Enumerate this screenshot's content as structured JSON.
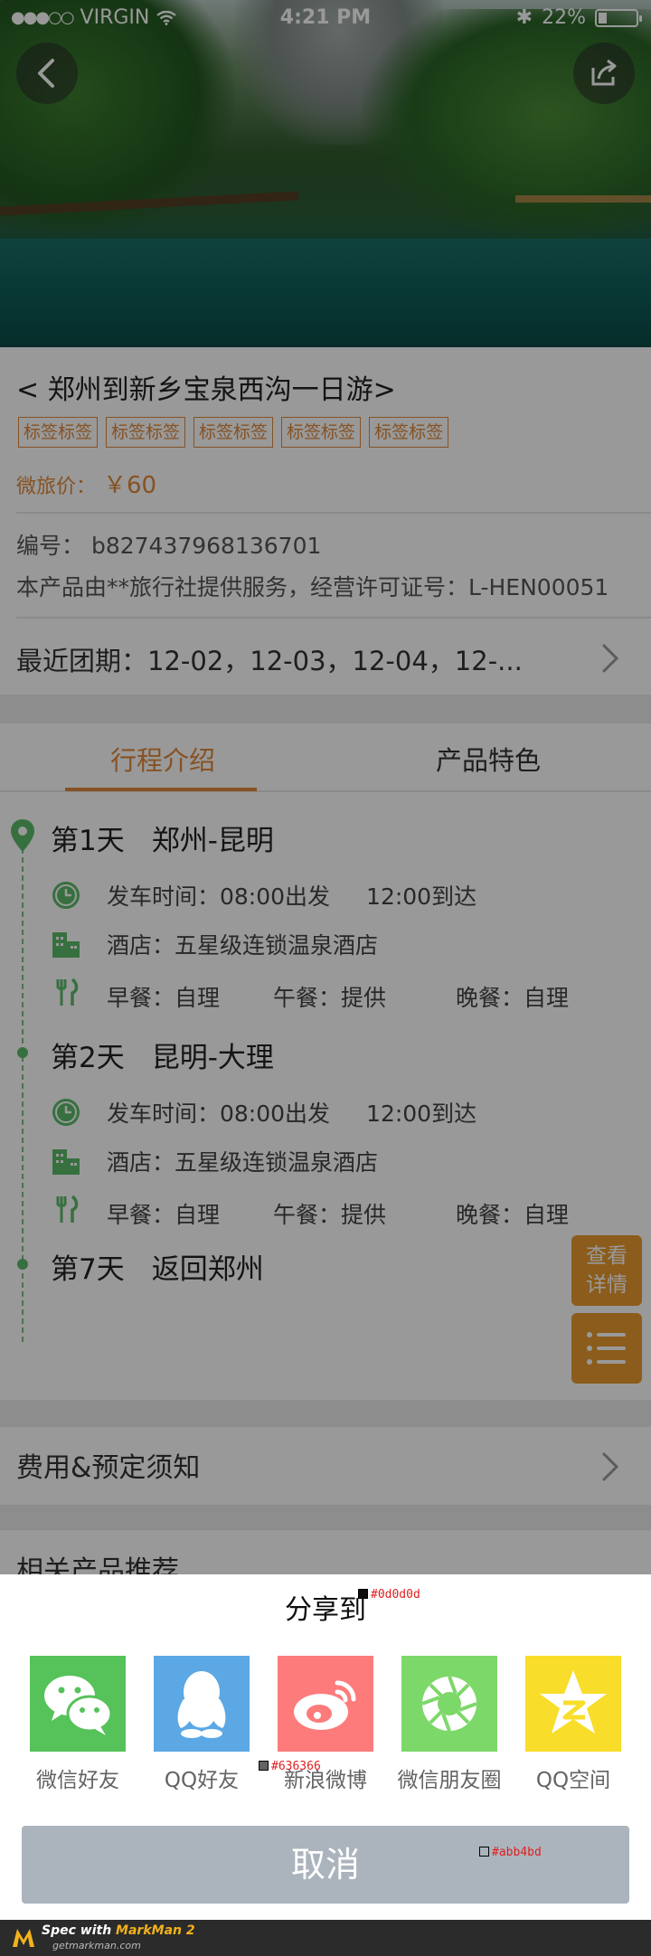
{
  "status_bar": {
    "carrier": "VIRGIN",
    "time": "4:21 PM",
    "battery": "22%",
    "battery_level": 0.22
  },
  "product": {
    "title": "< 郑州到新乡宝泉西沟一日游>",
    "tags": [
      "标签标签",
      "标签标签",
      "标签标签",
      "标签标签",
      "标签标签"
    ],
    "price_label": "微旅价：",
    "price": "￥60",
    "code": "编号： b827437968136701",
    "provider": "本产品由**旅行社提供服务，经营许可证号：L-HEN00051",
    "recent_dates": "最近团期：12-02，12-03，12-04，12-..."
  },
  "tabs": [
    {
      "label": "行程介绍",
      "active": true
    },
    {
      "label": "产品特色",
      "active": false
    }
  ],
  "itinerary": [
    {
      "day": "第1天",
      "route": "郑州-昆明",
      "depart": "发车时间：08:00出发",
      "arrive": "12:00到达",
      "hotel": "酒店：五星级连锁温泉酒店",
      "meals": [
        "早餐：自理",
        "午餐：提供",
        "晚餐：自理"
      ]
    },
    {
      "day": "第2天",
      "route": "昆明-大理",
      "depart": "发车时间：08:00出发",
      "arrive": "12:00到达",
      "hotel": "酒店：五星级连锁温泉酒店",
      "meals": [
        "早餐：自理",
        "午餐：提供",
        "晚餐：自理"
      ]
    },
    {
      "day": "第7天",
      "route": "返回郑州"
    }
  ],
  "fab": {
    "detail_line1": "查看",
    "detail_line2": "详情"
  },
  "sections": {
    "fee": "费用&预定须知",
    "related": "相关产品推荐"
  },
  "share": {
    "title": "分享到",
    "items": [
      {
        "label": "微信好友",
        "icon": "wechat-icon",
        "color": "#56c25a"
      },
      {
        "label": "QQ好友",
        "icon": "qq-icon",
        "color": "#5ba8e5"
      },
      {
        "label": "新浪微博",
        "icon": "weibo-icon",
        "color": "#fd7b7b"
      },
      {
        "label": "微信朋友圈",
        "icon": "moments-icon",
        "color": "#7dd86a"
      },
      {
        "label": "QQ空间",
        "icon": "qzone-icon",
        "color": "#f8dd2a"
      }
    ],
    "cancel": "取消"
  },
  "annotations": {
    "title_color": "#0d0d0d",
    "label_color": "#636366",
    "cancel_color": "#abb4bd"
  },
  "footer": {
    "spec_with": "Spec with",
    "brand": "MarkMan 2",
    "site": "getmarkman.com"
  },
  "colors": {
    "accent": "#e0893c",
    "green": "#5cbb6a",
    "fab": "#e89a2e"
  }
}
